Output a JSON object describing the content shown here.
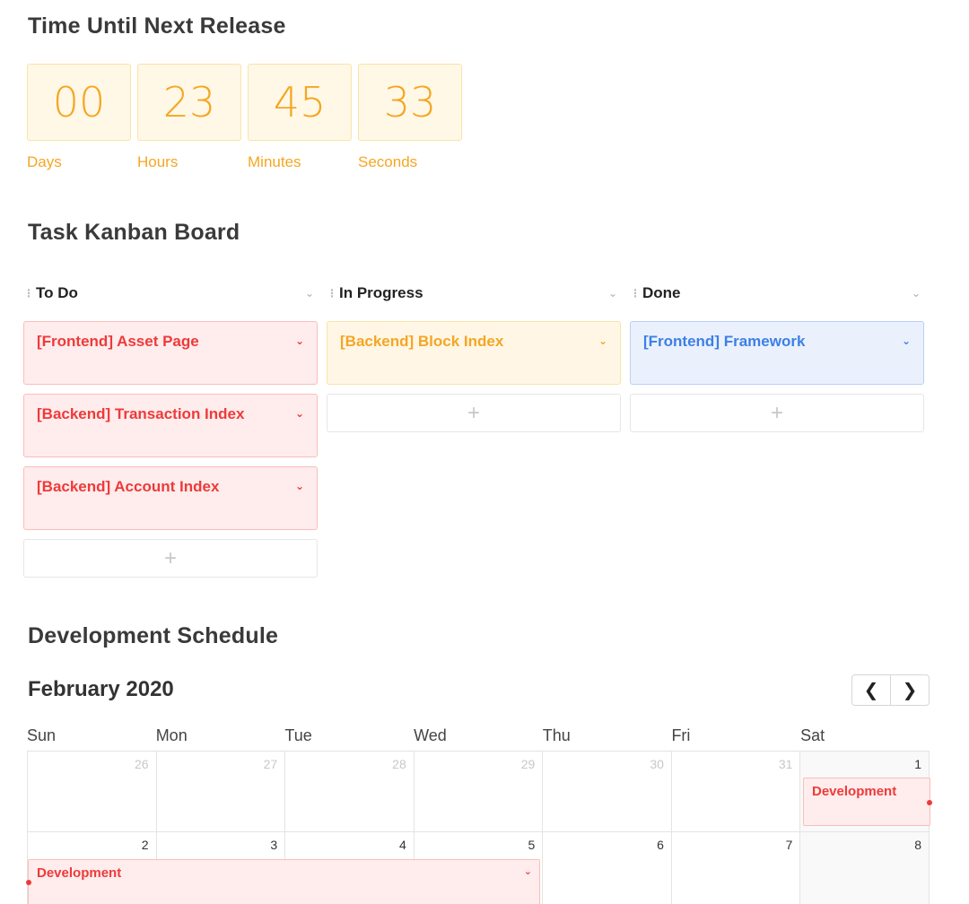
{
  "countdown": {
    "title": "Time Until Next Release",
    "units": [
      {
        "value": "00",
        "label": "Days"
      },
      {
        "value": "23",
        "label": "Hours"
      },
      {
        "value": "45",
        "label": "Minutes"
      },
      {
        "value": "33",
        "label": "Seconds"
      }
    ]
  },
  "kanban": {
    "title": "Task Kanban Board",
    "add_symbol": "+",
    "columns": [
      {
        "title": "To Do",
        "cards": [
          "[Frontend] Asset Page",
          "[Backend] Transaction Index",
          "[Backend] Account Index"
        ],
        "color": "#ee3a3a"
      },
      {
        "title": "In Progress",
        "cards": [
          "[Backend] Block Index"
        ],
        "color": "#f5a623"
      },
      {
        "title": "Done",
        "cards": [
          "[Frontend] Framework"
        ],
        "color": "#3d7fe6"
      }
    ]
  },
  "schedule": {
    "title": "Development Schedule",
    "month": "February 2020",
    "prev_icon": "chevron-left-icon",
    "next_icon": "chevron-right-icon",
    "weekdays": [
      "Sun",
      "Mon",
      "Tue",
      "Wed",
      "Thu",
      "Fri",
      "Sat"
    ],
    "weeks": [
      [
        "26",
        "27",
        "28",
        "29",
        "30",
        "31",
        "1"
      ],
      [
        "2",
        "3",
        "4",
        "5",
        "6",
        "7",
        "8"
      ]
    ],
    "events": [
      {
        "label": "Development"
      },
      {
        "label": "Development"
      }
    ]
  }
}
